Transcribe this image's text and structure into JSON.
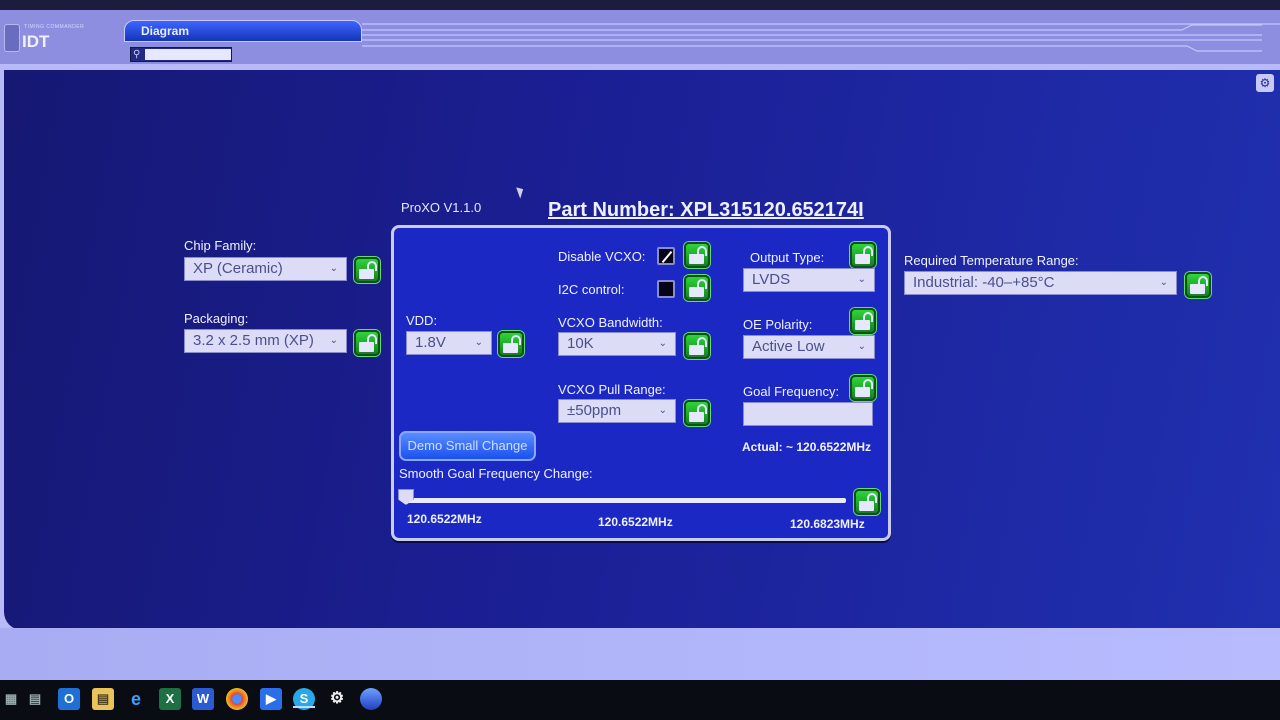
{
  "app": {
    "logo_small": "TIMING COMMANDER",
    "logo_text": "IDT",
    "tab_label": "Diagram",
    "search": {
      "value": "",
      "placeholder": ""
    }
  },
  "proxo": {
    "version": "ProXO V1.1.0",
    "part_number": "Part Number: XPL315120.652174I"
  },
  "left": {
    "chip_family": {
      "label": "Chip Family:",
      "value": "XP (Ceramic)"
    },
    "packaging": {
      "label": "Packaging:",
      "value": "3.2 x 2.5 mm (XP)"
    }
  },
  "right": {
    "temp_range": {
      "label": "Required Temperature Range:",
      "value": "Industrial: -40–+85°C"
    }
  },
  "panel": {
    "vdd": {
      "label": "VDD:",
      "value": "1.8V"
    },
    "disable_vcxo": {
      "label": "Disable VCXO:",
      "checked": true
    },
    "i2c_control": {
      "label": "I2C control:",
      "checked": false
    },
    "vcxo_bandwidth": {
      "label": "VCXO Bandwidth:",
      "value": "10K"
    },
    "vcxo_pull_range": {
      "label": "VCXO Pull Range:",
      "value": "±50ppm"
    },
    "output_type": {
      "label": "Output Type:",
      "value": "LVDS"
    },
    "oe_polarity": {
      "label": "OE Polarity:",
      "value": "Active Low"
    },
    "goal_frequency": {
      "label": "Goal Frequency:",
      "value": ""
    },
    "actual": "Actual: ~ 120.6522MHz",
    "demo_button": "Demo Small Change",
    "slider": {
      "label": "Smooth Goal Frequency Change:",
      "min_label": "120.6522MHz",
      "mid_label": "120.6522MHz",
      "max_label": "120.6823MHz",
      "position_fraction": 0.0
    }
  },
  "taskbar": {
    "icons": [
      "start-icon",
      "task-view-icon",
      "outlook-icon",
      "file-explorer-icon",
      "edge-icon",
      "excel-icon",
      "word-icon",
      "chrome-icon",
      "powerautomate-icon",
      "skype-icon",
      "settings-icon",
      "timing-commander-icon"
    ]
  },
  "colors": {
    "accent_green": "#2ac436",
    "panel_blue": "#1c28c4",
    "background_blue": "#1b1f95"
  }
}
